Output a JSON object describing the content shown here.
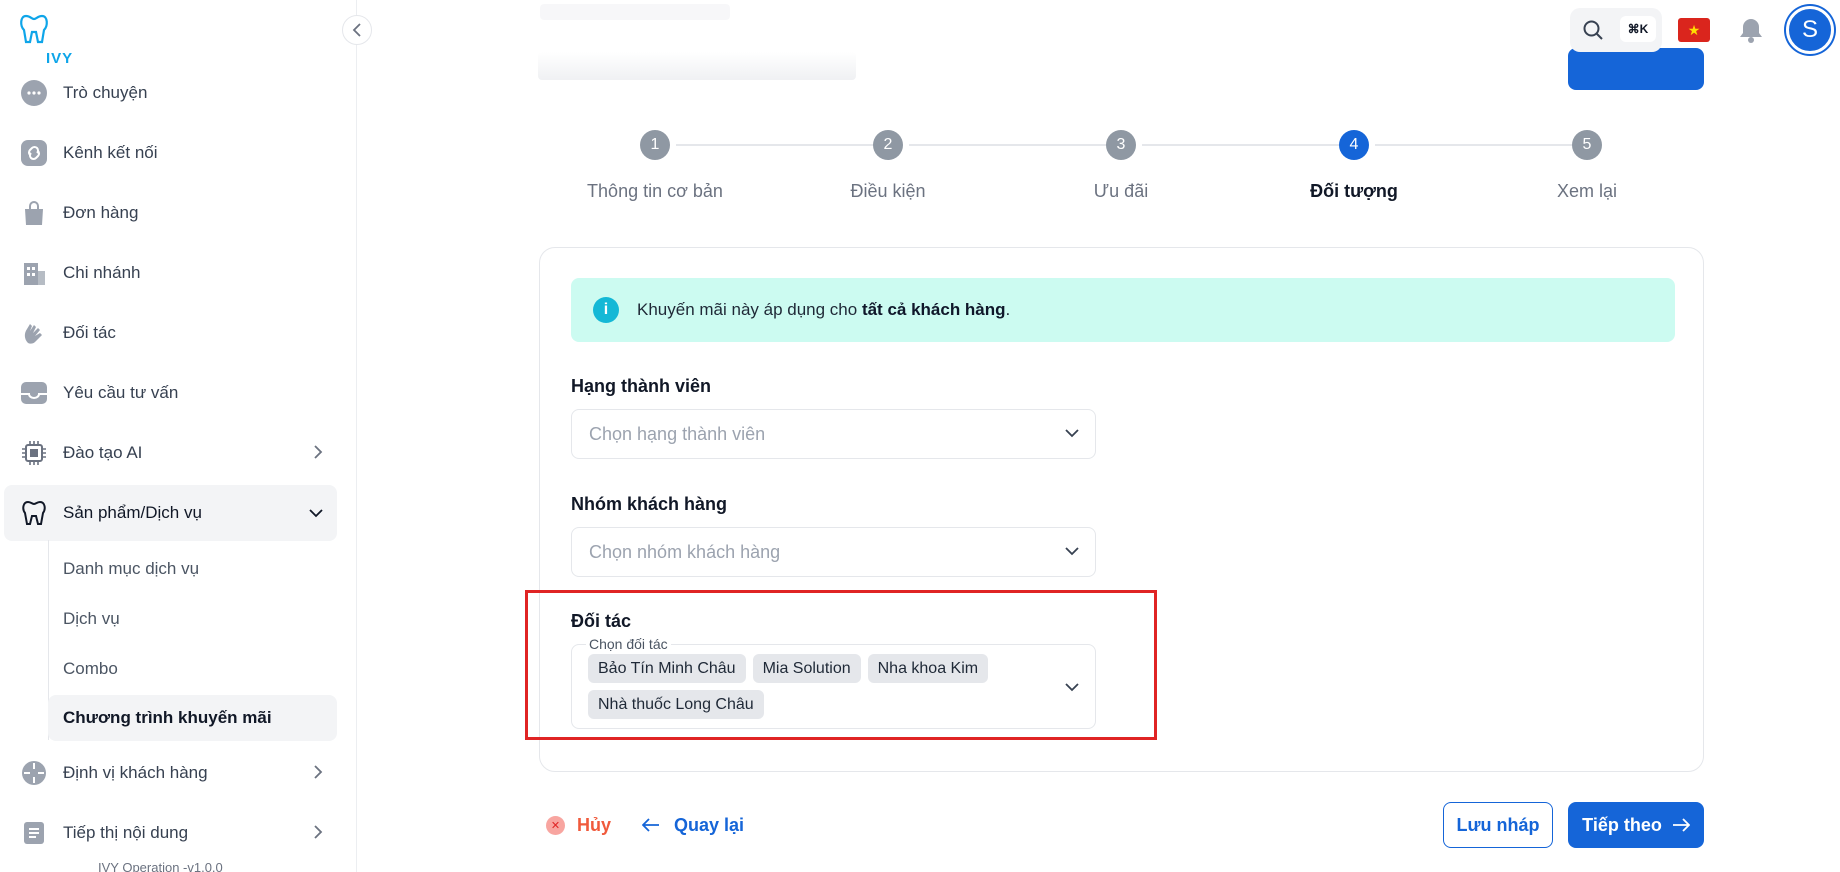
{
  "sidebar": {
    "brand": "IVY",
    "items": [
      {
        "label": "Trò chuyện",
        "icon": "chat-bubble-icon"
      },
      {
        "label": "Kênh kết nối",
        "icon": "link-icon"
      },
      {
        "label": "Đơn hàng",
        "icon": "shopping-bag-icon"
      },
      {
        "label": "Chi nhánh",
        "icon": "building-icon"
      },
      {
        "label": "Đối tác",
        "icon": "handshake-icon"
      },
      {
        "label": "Yêu cầu tư vấn",
        "icon": "inbox-icon"
      },
      {
        "label": "Đào tạo AI",
        "icon": "cpu-chip-icon"
      },
      {
        "label": "Sản phẩm/Dịch vụ",
        "icon": "tooth-icon"
      },
      {
        "label": "Định vị khách hàng",
        "icon": "crosshair-icon"
      },
      {
        "label": "Tiếp thị nội dung",
        "icon": "document-icon"
      }
    ],
    "sub_items": [
      {
        "label": "Danh mục dịch vụ"
      },
      {
        "label": "Dịch vụ"
      },
      {
        "label": "Combo"
      },
      {
        "label": "Chương trình khuyến mãi"
      }
    ],
    "version": "IVY Operation -v1.0.0"
  },
  "topbar": {
    "shortcut": "⌘K",
    "avatar_initial": "S"
  },
  "steps": [
    {
      "num": "1",
      "label": "Thông tin cơ bản"
    },
    {
      "num": "2",
      "label": "Điều kiện"
    },
    {
      "num": "3",
      "label": "Ưu đãi"
    },
    {
      "num": "4",
      "label": "Đối tượng"
    },
    {
      "num": "5",
      "label": "Xem lại"
    }
  ],
  "info": {
    "prefix": "Khuyến mãi này áp dụng cho ",
    "bold": "tất cả khách hàng",
    "suffix": "."
  },
  "form": {
    "member_tier": {
      "label": "Hạng thành viên",
      "placeholder": "Chọn hạng thành viên"
    },
    "customer_group": {
      "label": "Nhóm khách hàng",
      "placeholder": "Chọn nhóm khách hàng"
    },
    "partner": {
      "label": "Đối tác",
      "legend": "Chọn đối tác",
      "selected": [
        "Bảo Tín Minh Châu",
        "Mia Solution",
        "Nha khoa Kim",
        "Nhà thuốc Long Châu"
      ]
    }
  },
  "footer": {
    "cancel": "Hủy",
    "back": "Quay lại",
    "draft": "Lưu nháp",
    "next": "Tiếp theo"
  },
  "colors": {
    "primary": "#1565d8",
    "info_bg": "#ccfbf1",
    "highlight": "#e02424"
  }
}
